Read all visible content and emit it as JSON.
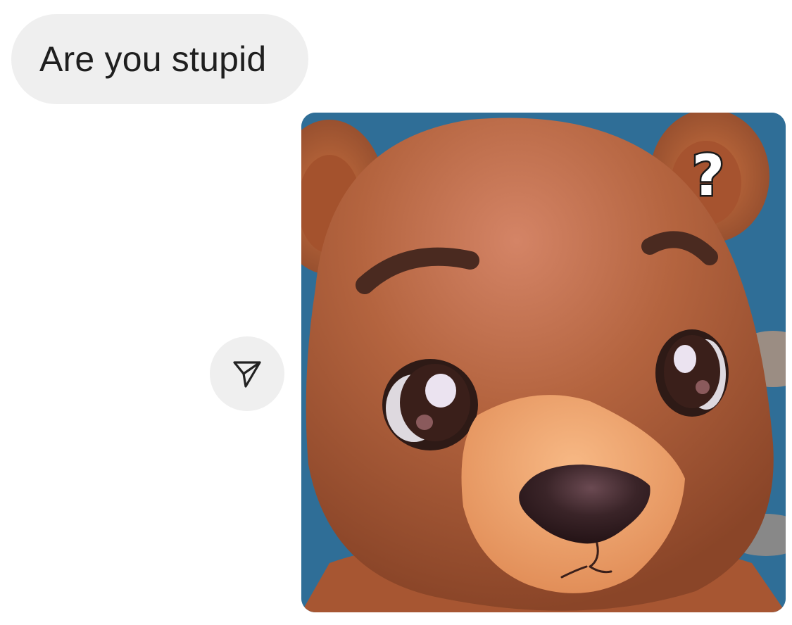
{
  "conversation": {
    "incoming_message": {
      "text": "Are you stupid"
    },
    "share_button": {
      "icon": "send-icon"
    },
    "image_message": {
      "subject": "bear-character-portrait",
      "overlay_glyph": "?"
    }
  },
  "colors": {
    "bubble_background": "#efefef",
    "text": "#1f1f1f",
    "sky": "#2f6e97",
    "bear_fur": "#b4643f",
    "bear_muzzle": "#f0a672",
    "bear_nose": "#3a2428",
    "bear_eye": "#2e1a16"
  }
}
